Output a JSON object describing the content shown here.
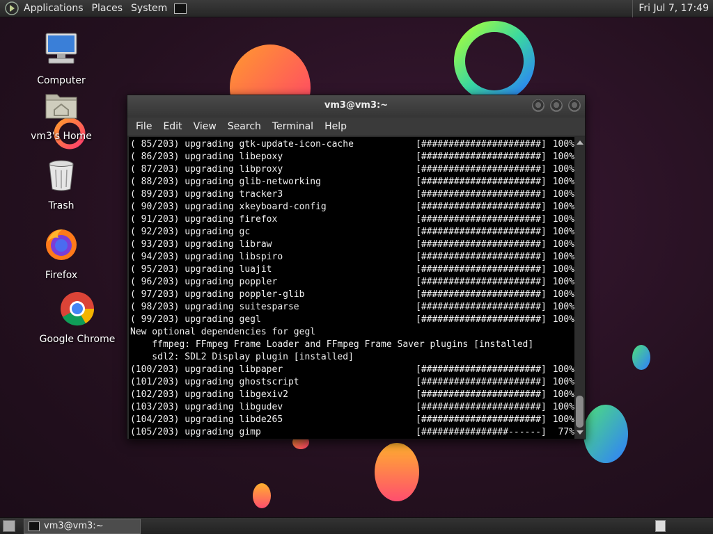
{
  "top_panel": {
    "menus": [
      "Applications",
      "Places",
      "System"
    ],
    "clock": "Fri Jul 7, 17:49"
  },
  "desktop": {
    "icons": [
      {
        "label": "Computer",
        "icon": "computer-icon"
      },
      {
        "label": "vm3's Home",
        "icon": "home-folder-icon"
      },
      {
        "label": "Trash",
        "icon": "trash-icon"
      },
      {
        "label": "Firefox",
        "icon": "firefox-icon"
      },
      {
        "label": "Google Chrome",
        "icon": "chrome-icon"
      }
    ]
  },
  "terminal": {
    "title": "vm3@vm3:~",
    "menu": [
      "File",
      "Edit",
      "View",
      "Search",
      "Terminal",
      "Help"
    ],
    "lines": [
      {
        "text": "( 85/203) upgrading gtk-update-icon-cache",
        "bar": "[######################]",
        "pct": "100%"
      },
      {
        "text": "( 86/203) upgrading libepoxy",
        "bar": "[######################]",
        "pct": "100%"
      },
      {
        "text": "( 87/203) upgrading libproxy",
        "bar": "[######################]",
        "pct": "100%"
      },
      {
        "text": "( 88/203) upgrading glib-networking",
        "bar": "[######################]",
        "pct": "100%"
      },
      {
        "text": "( 89/203) upgrading tracker3",
        "bar": "[######################]",
        "pct": "100%"
      },
      {
        "text": "( 90/203) upgrading xkeyboard-config",
        "bar": "[######################]",
        "pct": "100%"
      },
      {
        "text": "( 91/203) upgrading firefox",
        "bar": "[######################]",
        "pct": "100%"
      },
      {
        "text": "( 92/203) upgrading gc",
        "bar": "[######################]",
        "pct": "100%"
      },
      {
        "text": "( 93/203) upgrading libraw",
        "bar": "[######################]",
        "pct": "100%"
      },
      {
        "text": "( 94/203) upgrading libspiro",
        "bar": "[######################]",
        "pct": "100%"
      },
      {
        "text": "( 95/203) upgrading luajit",
        "bar": "[######################]",
        "pct": "100%"
      },
      {
        "text": "( 96/203) upgrading poppler",
        "bar": "[######################]",
        "pct": "100%"
      },
      {
        "text": "( 97/203) upgrading poppler-glib",
        "bar": "[######################]",
        "pct": "100%"
      },
      {
        "text": "( 98/203) upgrading suitesparse",
        "bar": "[######################]",
        "pct": "100%"
      },
      {
        "text": "( 99/203) upgrading gegl",
        "bar": "[######################]",
        "pct": "100%"
      },
      {
        "text": "New optional dependencies for gegl",
        "bar": "",
        "pct": ""
      },
      {
        "text": "    ffmpeg: FFmpeg Frame Loader and FFmpeg Frame Saver plugins [installed]",
        "bar": "",
        "pct": ""
      },
      {
        "text": "    sdl2: SDL2 Display plugin [installed]",
        "bar": "",
        "pct": ""
      },
      {
        "text": "(100/203) upgrading libpaper",
        "bar": "[######################]",
        "pct": "100%"
      },
      {
        "text": "(101/203) upgrading ghostscript",
        "bar": "[######################]",
        "pct": "100%"
      },
      {
        "text": "(102/203) upgrading libgexiv2",
        "bar": "[######################]",
        "pct": "100%"
      },
      {
        "text": "(103/203) upgrading libgudev",
        "bar": "[######################]",
        "pct": "100%"
      },
      {
        "text": "(104/203) upgrading libde265",
        "bar": "[######################]",
        "pct": "100%"
      },
      {
        "text": "(105/203) upgrading gimp",
        "bar": "[################------]",
        "pct": "77%"
      }
    ]
  },
  "bottom_panel": {
    "task_label": "vm3@vm3:~"
  }
}
